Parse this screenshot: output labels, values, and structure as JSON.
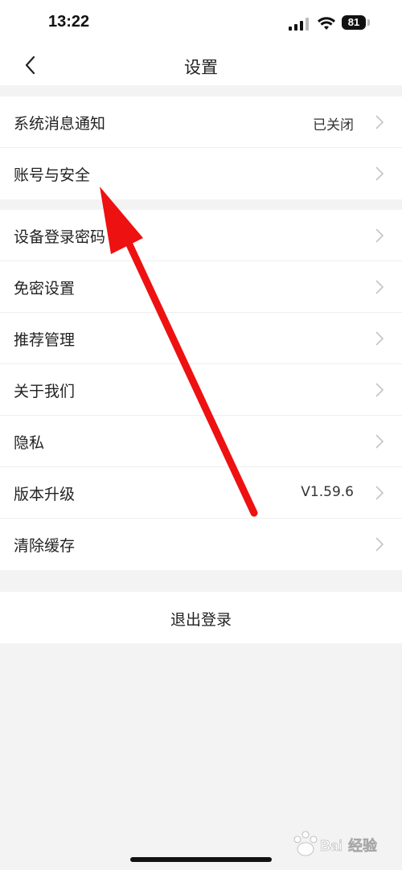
{
  "status_bar": {
    "time": "13:22",
    "battery": "81"
  },
  "header": {
    "title": "设置",
    "back_icon": "chevron-left-icon"
  },
  "groups": [
    {
      "items": [
        {
          "label": "系统消息通知",
          "value": "已关闭"
        },
        {
          "label": "账号与安全",
          "value": ""
        }
      ]
    },
    {
      "items": [
        {
          "label": "设备登录密码",
          "value": ""
        },
        {
          "label": "免密设置",
          "value": ""
        },
        {
          "label": "推荐管理",
          "value": ""
        },
        {
          "label": "关于我们",
          "value": ""
        },
        {
          "label": "隐私",
          "value": ""
        },
        {
          "label": "版本升级",
          "value": "V1.59.6"
        },
        {
          "label": "清除缓存",
          "value": ""
        }
      ]
    }
  ],
  "logout_label": "退出登录",
  "annotation": {
    "arrow_color": "#ee1111"
  },
  "colors": {
    "background": "#f3f3f3",
    "card": "#ffffff",
    "text": "#222222",
    "chevron": "#c4c4c4"
  }
}
